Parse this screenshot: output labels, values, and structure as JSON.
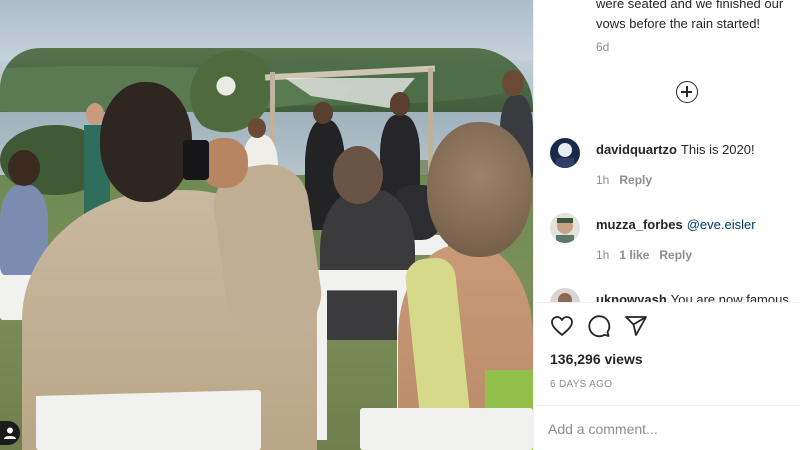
{
  "media": {
    "profile_icon": "user-profile-icon"
  },
  "caption": {
    "tail_text": "were seated and we finished our vows before the rain started!",
    "age": "6d"
  },
  "load_more_icon": "plus-circle-icon",
  "comments": [
    {
      "username": "davidquartzo",
      "text": "This is 2020!",
      "mention": "",
      "age": "1h",
      "likes": "",
      "reply_label": "Reply"
    },
    {
      "username": "muzza_forbes",
      "text": "",
      "mention": "@eve.eisler",
      "age": "1h",
      "likes": "1 like",
      "reply_label": "Reply"
    },
    {
      "username": "uknowyash",
      "text": "You are now famous",
      "mention": "",
      "age": "",
      "likes": "",
      "reply_label": ""
    }
  ],
  "actions": {
    "like_icon": "heart-icon",
    "comment_icon": "comment-bubble-icon",
    "share_icon": "paper-plane-icon"
  },
  "stats": {
    "views": "136,296 views",
    "date": "6 DAYS AGO"
  },
  "add_comment": {
    "placeholder": "Add a comment..."
  },
  "colors": {
    "text": "#262626",
    "secondary": "#8e8e8e",
    "mention": "#00376b",
    "divider": "#efefef"
  }
}
